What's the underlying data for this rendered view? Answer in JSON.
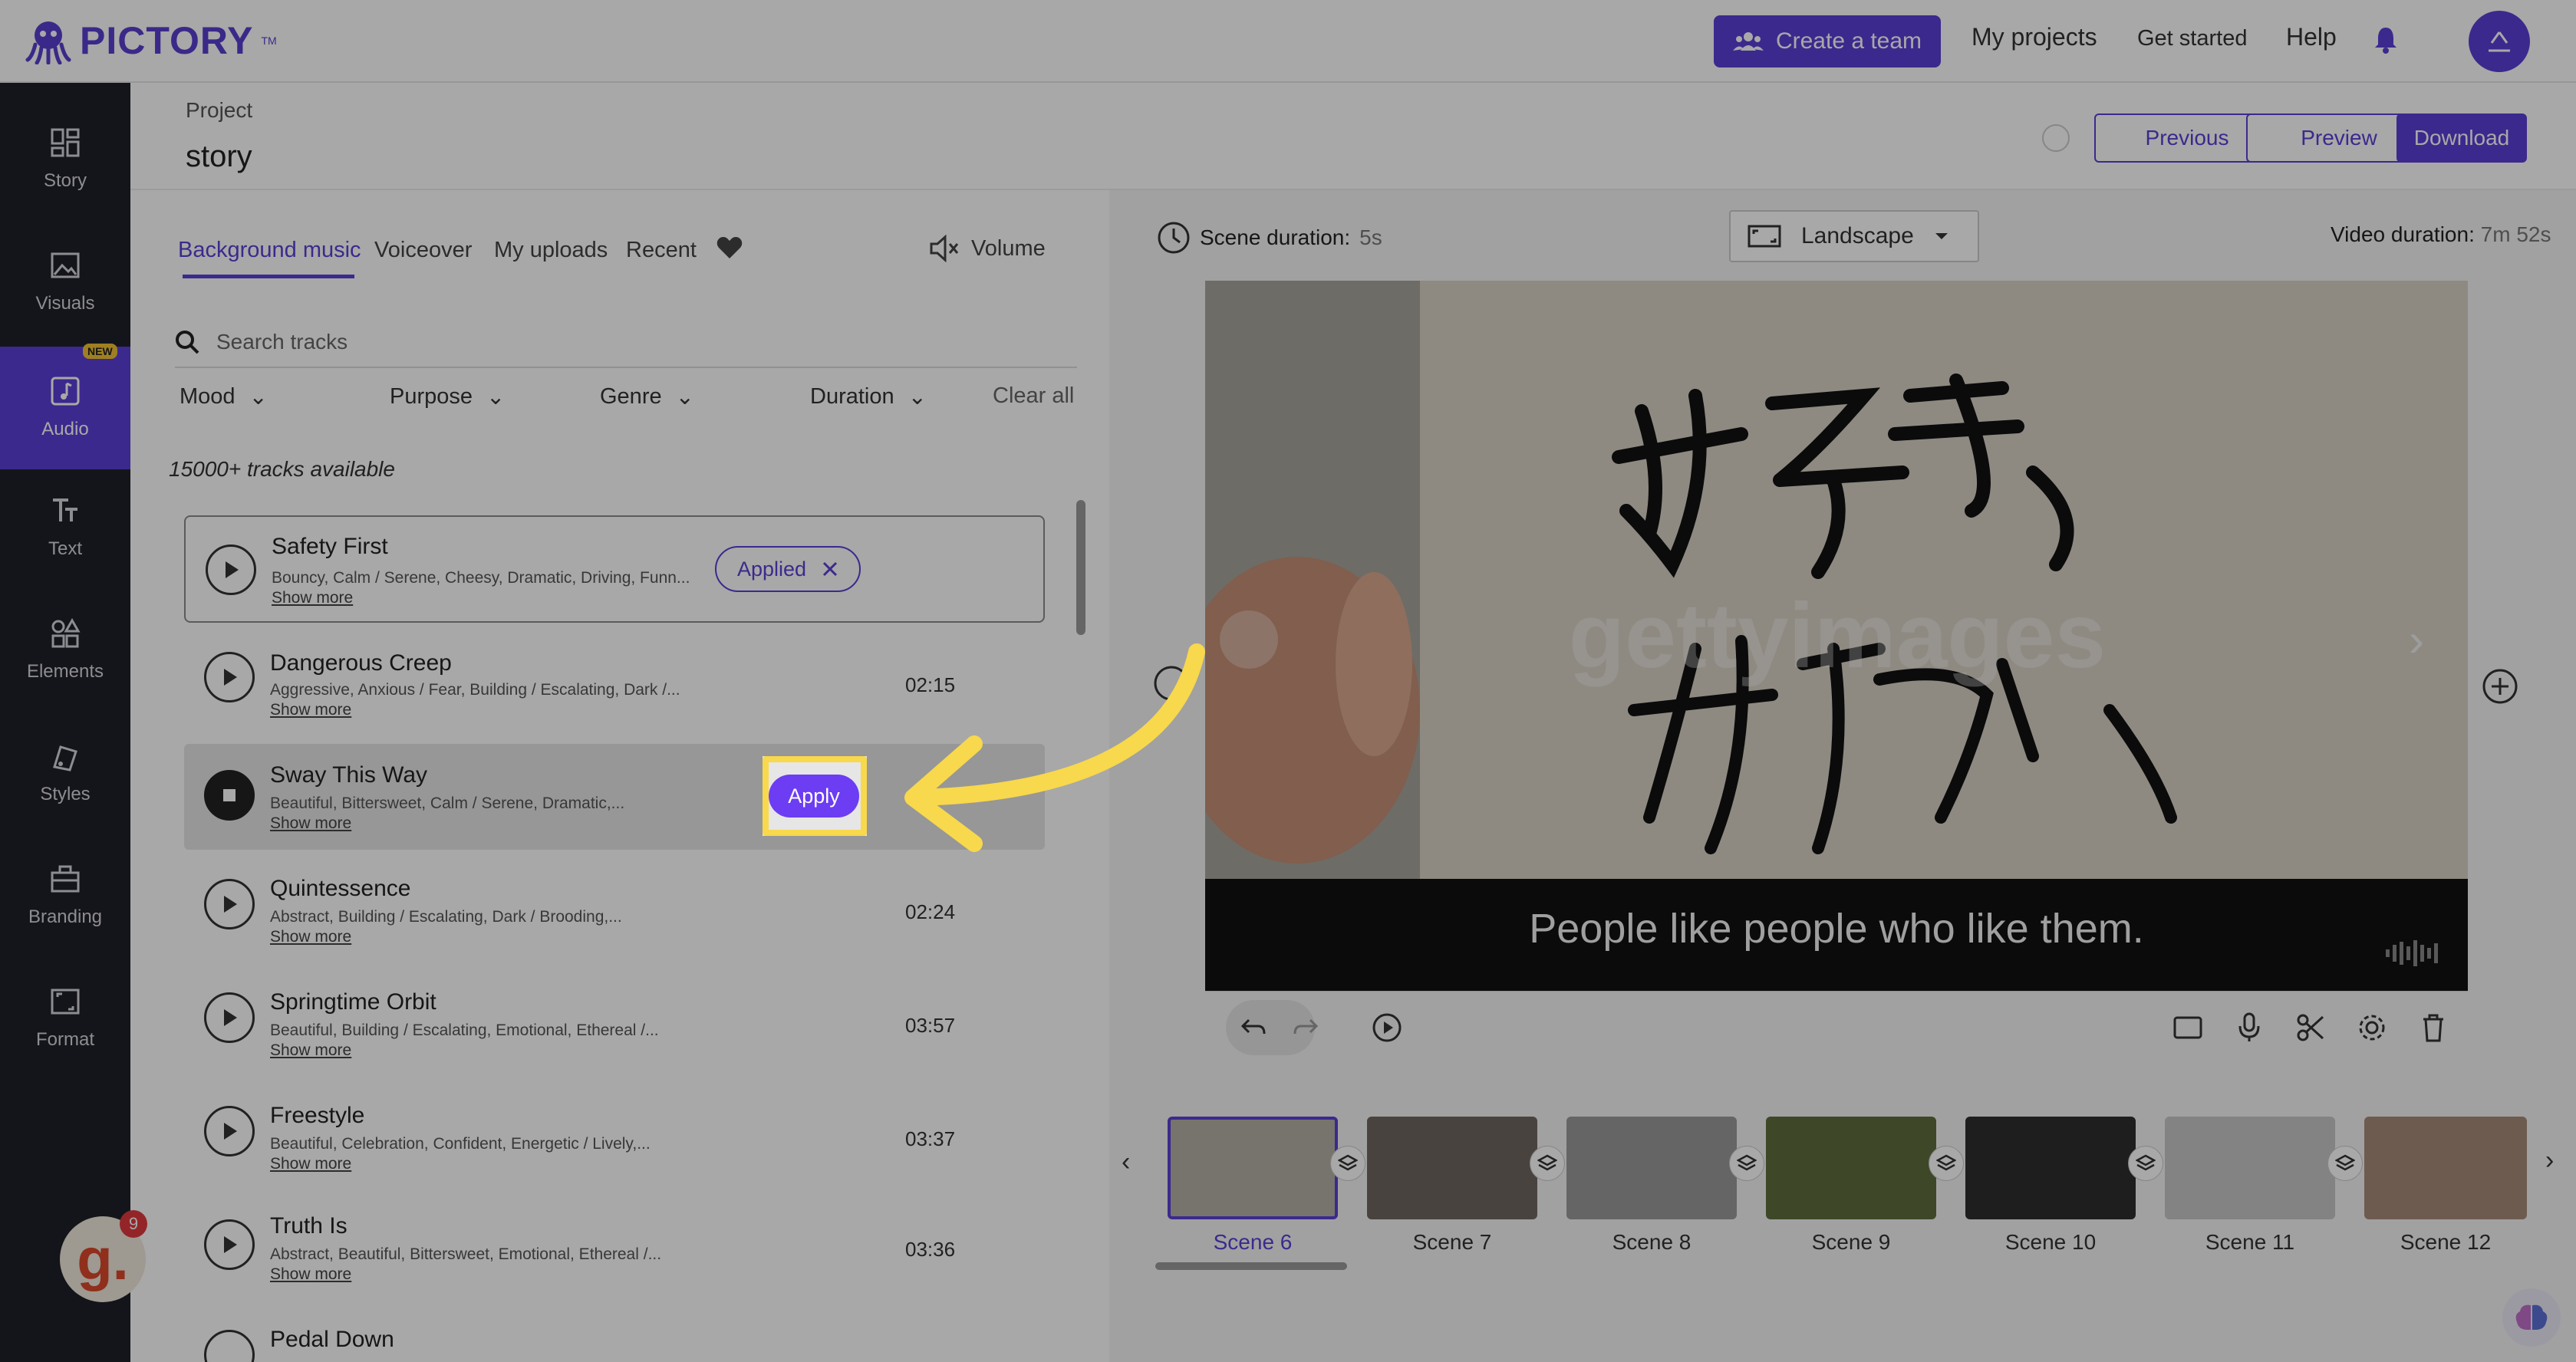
{
  "app": {
    "logo_text": "PICTORY",
    "logo_tm": "TM"
  },
  "topnav": {
    "create_team": "Create a team",
    "my_projects": "My projects",
    "get_started": "Get started",
    "help": "Help"
  },
  "sidebar": {
    "items": [
      {
        "label": "Story",
        "icon": "grid-icon"
      },
      {
        "label": "Visuals",
        "icon": "image-icon"
      },
      {
        "label": "Audio",
        "icon": "music-note-icon",
        "badge": "NEW"
      },
      {
        "label": "Text",
        "icon": "text-icon"
      },
      {
        "label": "Elements",
        "icon": "shapes-icon"
      },
      {
        "label": "Styles",
        "icon": "styles-icon"
      },
      {
        "label": "Branding",
        "icon": "briefcase-icon"
      },
      {
        "label": "Format",
        "icon": "format-icon"
      }
    ]
  },
  "project": {
    "label": "Project",
    "name": "story"
  },
  "header_buttons": {
    "previous": "Previous",
    "preview": "Preview",
    "download": "Download"
  },
  "audio_panel": {
    "tabs": [
      "Background music",
      "Voiceover",
      "My uploads",
      "Recent"
    ],
    "volume": "Volume",
    "search_placeholder": "Search tracks",
    "filters": [
      "Mood",
      "Purpose",
      "Genre",
      "Duration"
    ],
    "clear_all": "Clear all",
    "count": "15000+ tracks available",
    "show_more": "Show more",
    "applied": "Applied",
    "apply": "Apply",
    "tracks": [
      {
        "name": "Safety First",
        "tags": "Bouncy, Calm / Serene, Cheesy, Dramatic, Driving, Funn...",
        "duration": ""
      },
      {
        "name": "Dangerous Creep",
        "tags": "Aggressive, Anxious / Fear, Building / Escalating, Dark /...",
        "duration": "02:15"
      },
      {
        "name": "Sway This Way",
        "tags": "Beautiful, Bittersweet, Calm / Serene, Dramatic,...",
        "duration": ""
      },
      {
        "name": "Quintessence",
        "tags": "Abstract, Building / Escalating, Dark / Brooding,...",
        "duration": "02:24"
      },
      {
        "name": "Springtime Orbit",
        "tags": "Beautiful, Building / Escalating, Emotional, Ethereal /...",
        "duration": "03:57"
      },
      {
        "name": "Freestyle",
        "tags": "Beautiful, Celebration, Confident, Energetic / Lively,...",
        "duration": "03:37"
      },
      {
        "name": "Truth Is",
        "tags": "Abstract, Beautiful, Bittersweet, Emotional, Ethereal /...",
        "duration": "03:36"
      },
      {
        "name": "Pedal Down",
        "tags": "",
        "duration": ""
      }
    ]
  },
  "editor": {
    "scene_duration_label": "Scene duration:",
    "scene_duration_value": "5s",
    "orientation": "Landscape",
    "video_duration_label": "Video duration:",
    "video_duration_value": "7m 52s",
    "caption": "People like people who like them.",
    "watermark": "gettyimages"
  },
  "scenes": [
    "Scene 6",
    "Scene 7",
    "Scene 8",
    "Scene 9",
    "Scene 10",
    "Scene 11",
    "Scene 12"
  ],
  "chat": {
    "badge": "9"
  },
  "colors": {
    "brand": "#5b3fd6",
    "highlight": "#f8d84c"
  }
}
